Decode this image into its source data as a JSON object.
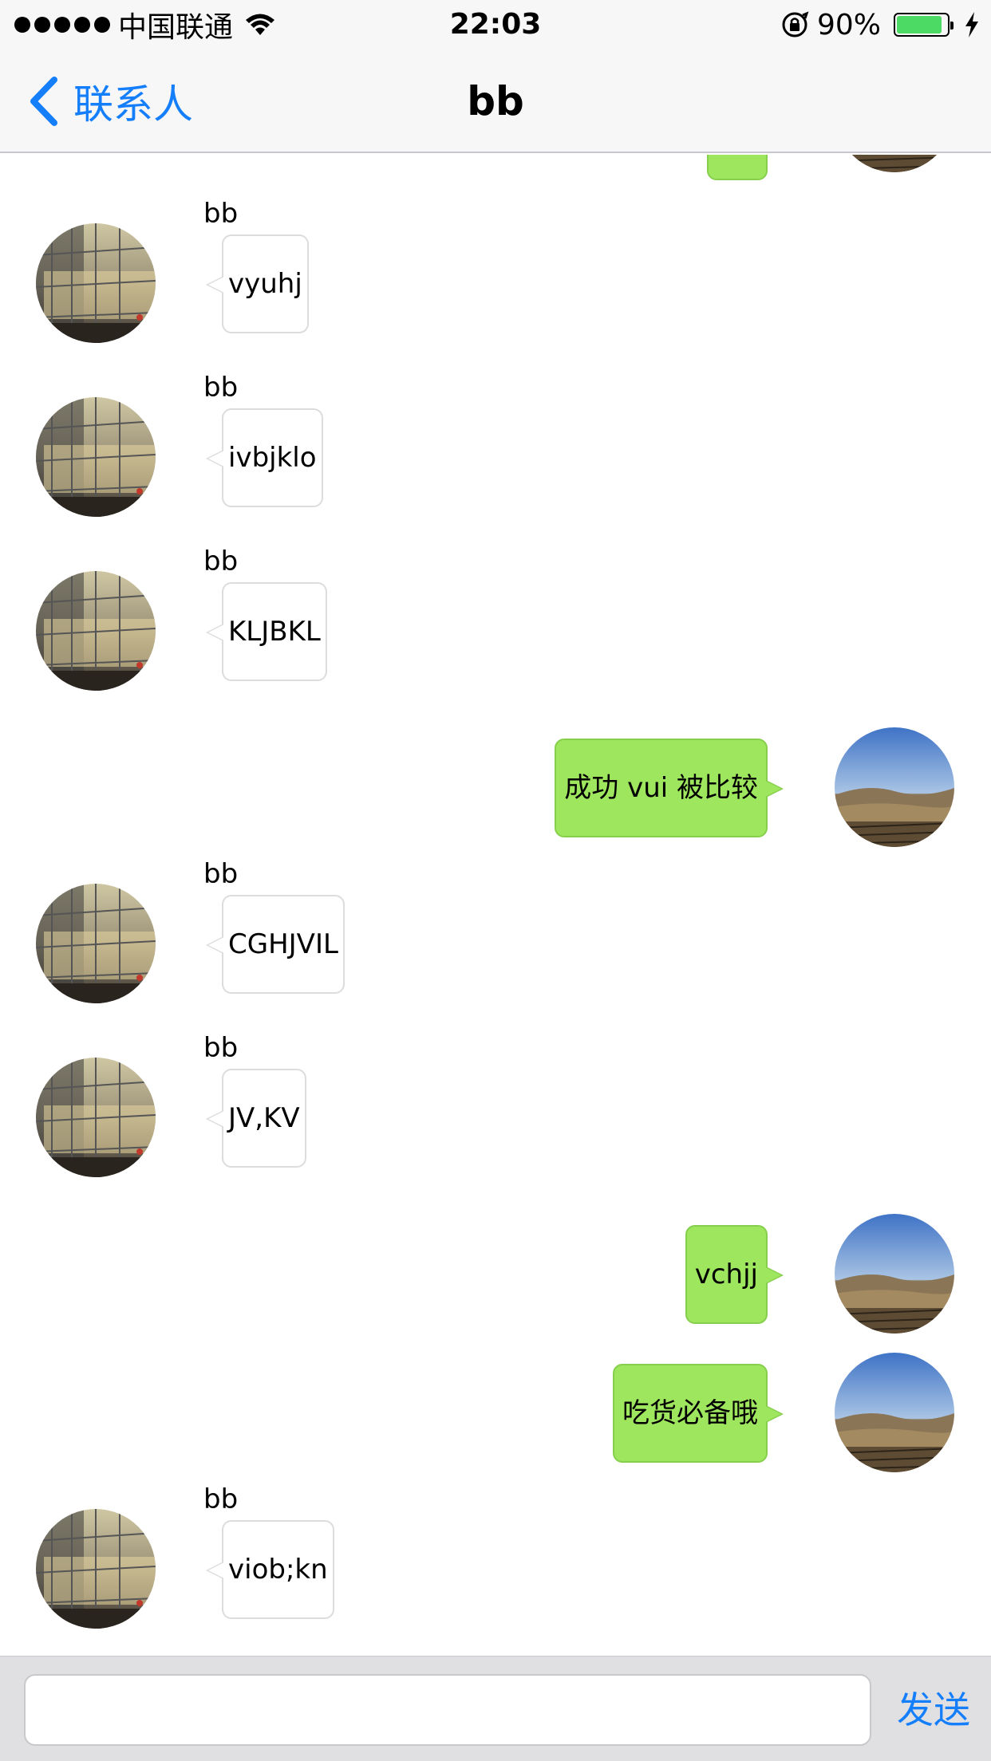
{
  "status_bar": {
    "carrier": "中国联通",
    "time": "22:03",
    "battery_percent": "90%",
    "battery_level": 0.9,
    "icons": [
      "signal-dots-icon",
      "wifi-icon",
      "rotation-lock-icon",
      "battery-icon",
      "charging-bolt-icon"
    ]
  },
  "nav": {
    "back_label": "联系人",
    "title": "bb"
  },
  "messages": [
    {
      "direction": "out",
      "sender": "",
      "text": ""
    },
    {
      "direction": "in",
      "sender": "bb",
      "text": "vyuhj"
    },
    {
      "direction": "in",
      "sender": "bb",
      "text": "ivbjklo"
    },
    {
      "direction": "in",
      "sender": "bb",
      "text": "KLJBKL"
    },
    {
      "direction": "out",
      "sender": "",
      "text": "成功 vui 被比较"
    },
    {
      "direction": "in",
      "sender": "bb",
      "text": "CGHJVIL"
    },
    {
      "direction": "in",
      "sender": "bb",
      "text": "JV,KV"
    },
    {
      "direction": "out",
      "sender": "",
      "text": "vchjj"
    },
    {
      "direction": "out",
      "sender": "",
      "text": "吃货必备哦"
    },
    {
      "direction": "in",
      "sender": "bb",
      "text": "viob;kn"
    }
  ],
  "input": {
    "value": "",
    "send_label": "发送"
  },
  "colors": {
    "accent": "#147efb",
    "outgoing_bubble": "#9ee65e",
    "incoming_bubble": "#ffffff",
    "battery": "#4cd964"
  }
}
